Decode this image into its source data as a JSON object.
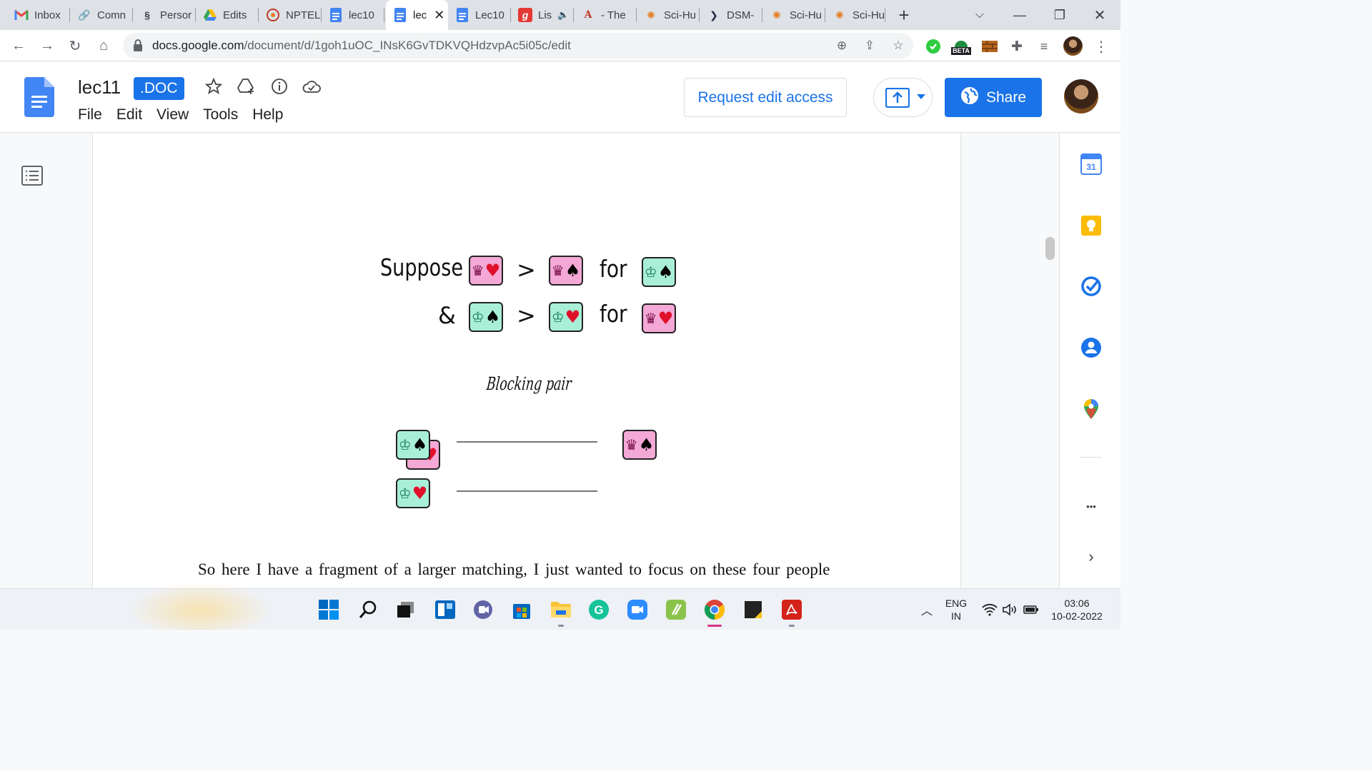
{
  "tabs": [
    {
      "label": "Inbox",
      "icon": "gmail-icon"
    },
    {
      "label": "Comn",
      "icon": "link-icon"
    },
    {
      "label": "Persor",
      "icon": "helix-icon"
    },
    {
      "label": "Edits",
      "icon": "drive-icon"
    },
    {
      "label": "NPTEL",
      "icon": "nptel-icon"
    },
    {
      "label": "lec10",
      "icon": "docs-icon"
    },
    {
      "label": "lec",
      "icon": "docs-icon",
      "active": true
    },
    {
      "label": "Lec10",
      "icon": "docs-icon"
    },
    {
      "label": "Lis",
      "icon": "g-icon"
    },
    {
      "label": "- The",
      "icon": "acrobat-icon"
    },
    {
      "label": "Sci-Hu",
      "icon": "scihub-icon"
    },
    {
      "label": "DSM-",
      "icon": "arrow-icon"
    },
    {
      "label": "Sci-Hu",
      "icon": "scihub-icon"
    },
    {
      "label": "Sci-Hu",
      "icon": "scihub-icon"
    }
  ],
  "address": {
    "host": "docs.google.com",
    "path": "/document/d/1goh1uOC_INsK6GvTDKVQHdzvpAc5i05c/edit"
  },
  "extension_badge": "BETA",
  "doc": {
    "title": "lec11",
    "badge": ".DOC",
    "menu": [
      "File",
      "Edit",
      "View",
      "Tools",
      "Help"
    ],
    "request_label": "Request edit access",
    "share_label": "Share"
  },
  "figure": {
    "suppose": "Suppose",
    "amp": "&",
    "gt": ">",
    "for_label": "for",
    "blocking_pair": "Blocking pair"
  },
  "paragraph": "So here I have a fragment of a larger matching, I just wanted to focus on these four people",
  "side_panel": {
    "calendar_day": "31",
    "more": "•••"
  },
  "tray": {
    "lang_top": "ENG",
    "lang_bottom": "IN",
    "time": "03:06",
    "date": "10-02-2022"
  },
  "colors": {
    "accent": "#1a73e8",
    "pink_card": "#f3a8d6",
    "mint_card": "#a9efd8",
    "heart": "#e0102a"
  }
}
